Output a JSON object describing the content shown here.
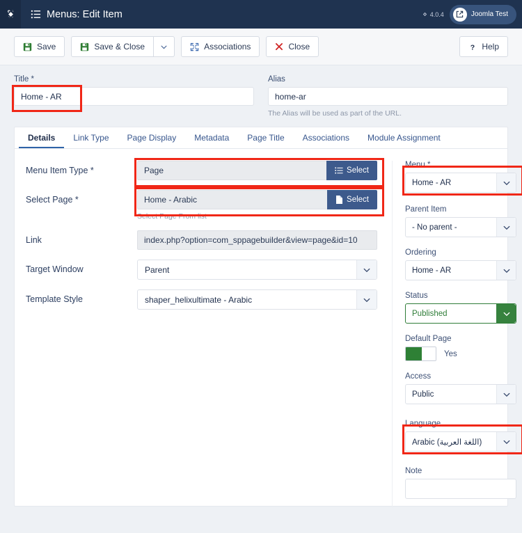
{
  "header": {
    "title": "Menus: Edit Item",
    "version": "4.0.4",
    "user": "Joomla Test",
    "logo_icon": "joomla-logo-icon",
    "menu_icon": "list-menu-icon",
    "external_icon": "external-link-icon"
  },
  "toolbar": {
    "save_label": "Save",
    "save_close_label": "Save & Close",
    "dropdown_icon": "chevron-down-icon",
    "associations_label": "Associations",
    "close_label": "Close",
    "help_label": "Help",
    "save_icon": "save-disk-icon",
    "associations_icon": "expand-arrows-icon",
    "close_icon": "x-mark-icon",
    "help_icon": "question-mark-icon"
  },
  "title_row": {
    "title_label": "Title *",
    "title_value": "Home - AR",
    "alias_label": "Alias",
    "alias_value": "home-ar",
    "alias_hint": "The Alias will be used as part of the URL."
  },
  "tabs": [
    {
      "label": "Details",
      "active": true
    },
    {
      "label": "Link Type",
      "active": false
    },
    {
      "label": "Page Display",
      "active": false
    },
    {
      "label": "Metadata",
      "active": false
    },
    {
      "label": "Page Title",
      "active": false
    },
    {
      "label": "Associations",
      "active": false
    },
    {
      "label": "Module Assignment",
      "active": false
    }
  ],
  "main": {
    "menu_item_type_label": "Menu Item Type *",
    "menu_item_type_value": "Page",
    "menu_item_type_select": "Select",
    "menu_item_type_select_icon": "list-icon",
    "select_page_label": "Select Page *",
    "select_page_value": "Home - Arabic",
    "select_page_select": "Select",
    "select_page_select_icon": "file-icon",
    "select_page_hint": "Select Page From list",
    "link_label": "Link",
    "link_value": "index.php?option=com_sppagebuilder&view=page&id=10",
    "target_window_label": "Target Window",
    "target_window_value": "Parent",
    "template_style_label": "Template Style",
    "template_style_value": "shaper_helixultimate - Arabic"
  },
  "side": {
    "menu_label": "Menu *",
    "menu_value": "Home - AR",
    "parent_item_label": "Parent Item",
    "parent_item_value": "- No parent -",
    "ordering_label": "Ordering",
    "ordering_value": "Home - AR",
    "status_label": "Status",
    "status_value": "Published",
    "default_page_label": "Default Page",
    "default_page_value": "Yes",
    "access_label": "Access",
    "access_value": "Public",
    "language_label": "Language",
    "language_value": "Arabic (اللغة العربية)",
    "note_label": "Note",
    "note_value": "",
    "note_placeholder": ""
  },
  "colors": {
    "header_bg": "#1f3350",
    "accent_blue": "#3d5a8c",
    "highlight_red": "#f02717",
    "status_green": "#2f7d38",
    "page_bg": "#eef1f5"
  }
}
